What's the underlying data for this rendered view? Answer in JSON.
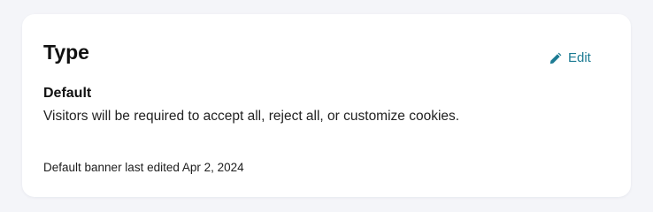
{
  "card": {
    "title": "Type",
    "edit_label": "Edit",
    "type_name": "Default",
    "type_description": "Visitors will be required to accept all, reject all, or customize cookies.",
    "last_edited": "Default banner last edited Apr 2, 2024"
  },
  "icons": {
    "edit": "pencil-icon"
  },
  "colors": {
    "accent": "#1c7b93",
    "background": "#f4f5f9",
    "card": "#ffffff",
    "text": "#111111"
  }
}
